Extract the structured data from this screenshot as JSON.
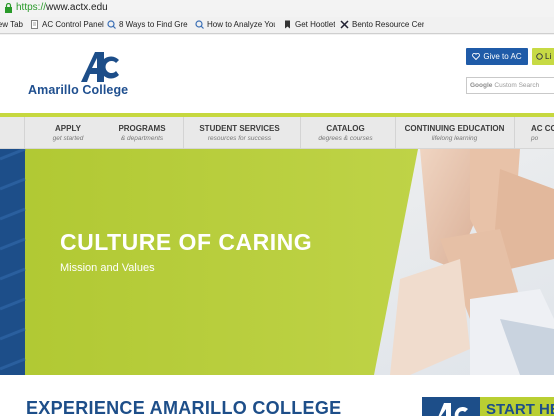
{
  "browser": {
    "url_scheme": "https://",
    "url_rest": "www.actx.edu",
    "bookmarks": [
      {
        "label": "New Tab",
        "icon": "blank-page-icon"
      },
      {
        "label": "AC Control Panel",
        "icon": "document-icon"
      },
      {
        "label": "8 Ways to Find Gre...",
        "icon": "search-icon"
      },
      {
        "label": "How to Analyze You...",
        "icon": "search-icon"
      },
      {
        "label": "Get Hootlet",
        "icon": "bookmark-icon"
      },
      {
        "label": "Bento Resource Cen...",
        "icon": "bento-icon"
      }
    ]
  },
  "header": {
    "logo_mark": "AC",
    "logo_text": "Amarillo College",
    "give_label": "Give to AC",
    "login_label": "Li",
    "search_brand": "Google",
    "search_placeholder": "Custom Search"
  },
  "nav": [
    {
      "title": "APPLY",
      "subtitle": "get started"
    },
    {
      "title": "PROGRAMS",
      "subtitle": "& departments"
    },
    {
      "title": "STUDENT SERVICES",
      "subtitle": "resources for success"
    },
    {
      "title": "CATALOG",
      "subtitle": "degrees & courses"
    },
    {
      "title": "CONTINUING EDUCATION",
      "subtitle": "lifelong learning"
    },
    {
      "title": "AC CO",
      "subtitle": "po"
    }
  ],
  "hero": {
    "title": "CULTURE OF CARING",
    "subtitle": "Mission and Values"
  },
  "bottom": {
    "title": "EXPERIENCE AMARILLO COLLEGE",
    "start_logo": "AC",
    "start_label": "START HE"
  },
  "colors": {
    "brand_blue": "#1d4e89",
    "brand_green": "#c6d83f",
    "hero_green": "#b8cf3a"
  }
}
